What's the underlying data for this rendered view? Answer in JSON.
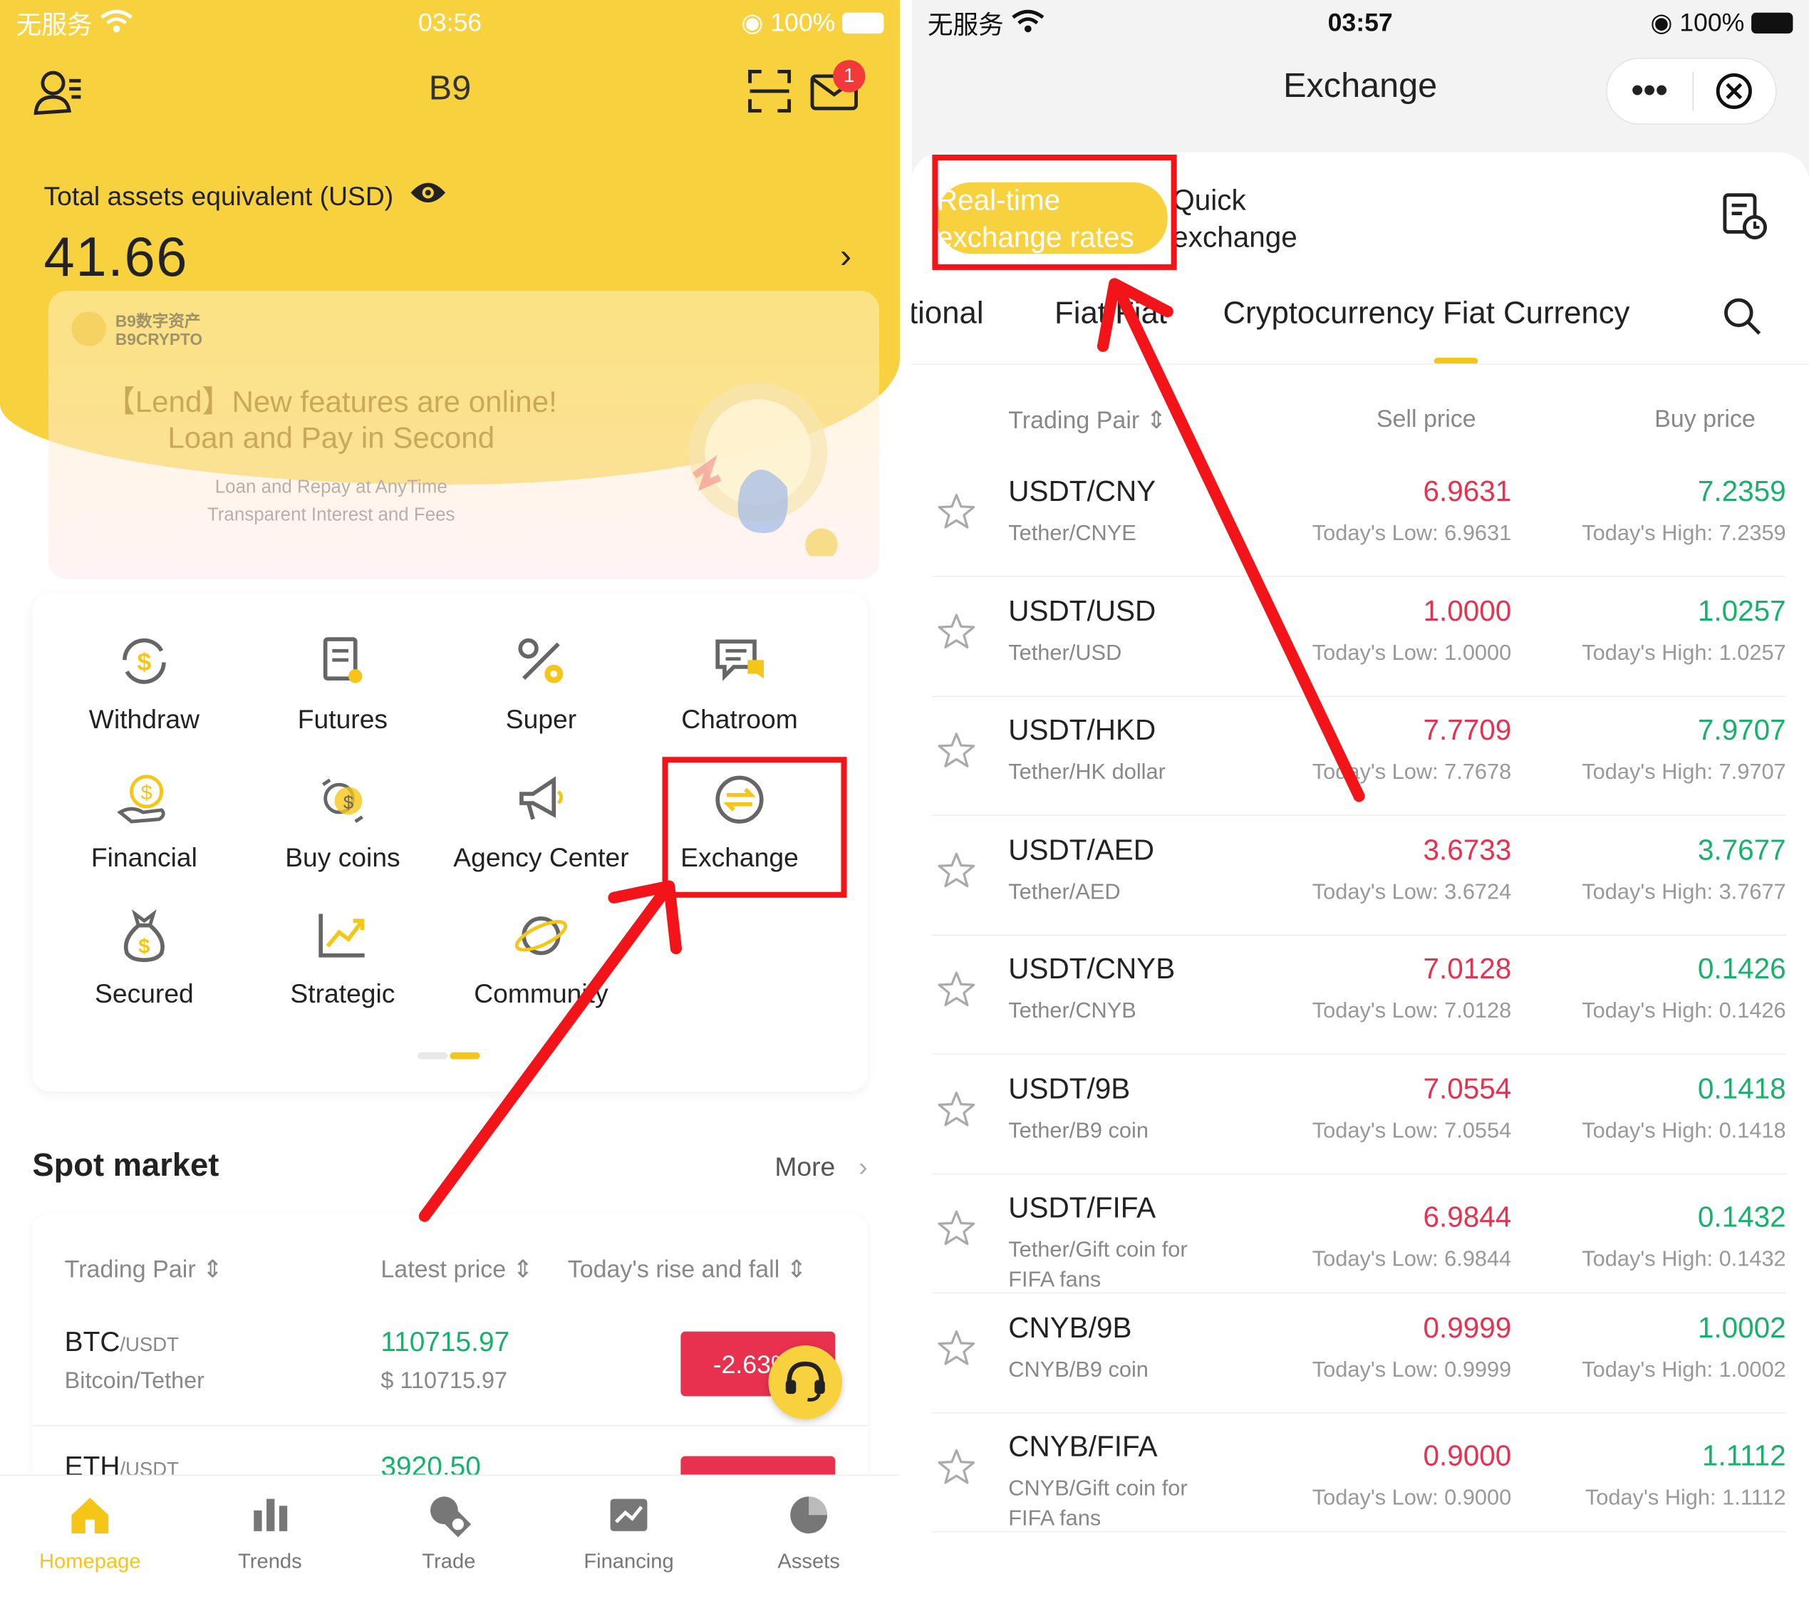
{
  "left": {
    "status": {
      "carrier": "无服务",
      "time": "03:56",
      "battery": "100%"
    },
    "header": {
      "title": "B9"
    },
    "message_badge": "1",
    "assets": {
      "label": "Total assets equivalent (USD)",
      "value": "41.66"
    },
    "banner": {
      "brand_cn": "B9数字资产",
      "brand_en": "B9CRYPTO",
      "line1": "【Lend】New features are online!",
      "line2": "Loan and Pay in Second",
      "line3": "Loan and Repay at AnyTime",
      "line4": "Transparent Interest and Fees"
    },
    "grid": [
      {
        "label": "Withdraw",
        "icon": "withdraw-icon"
      },
      {
        "label": "Futures",
        "icon": "futures-icon"
      },
      {
        "label": "Super",
        "icon": "super-icon"
      },
      {
        "label": "Chatroom",
        "icon": "chatroom-icon"
      },
      {
        "label": "Financial",
        "icon": "financial-icon"
      },
      {
        "label": "Buy coins",
        "icon": "buy-coins-icon"
      },
      {
        "label": "Agency Center",
        "icon": "megaphone-icon"
      },
      {
        "label": "Exchange",
        "icon": "exchange-icon"
      },
      {
        "label": "Secured",
        "icon": "money-bag-icon"
      },
      {
        "label": "Strategic",
        "icon": "chart-icon"
      },
      {
        "label": "Community",
        "icon": "planet-icon"
      }
    ],
    "spot": {
      "title": "Spot market",
      "more": "More",
      "col_pair": "Trading Pair",
      "col_price": "Latest price",
      "col_change": "Today's rise and fall",
      "rows": [
        {
          "base": "BTC",
          "quote": "/USDT",
          "name": "Bitcoin/Tether",
          "price": "110715.97",
          "usd": "$ 110715.97",
          "change": "-2.63"
        },
        {
          "base": "ETH",
          "quote": "/USDT",
          "name": "",
          "price": "3920.50",
          "usd": "",
          "change": ""
        }
      ]
    },
    "tabs": [
      "Homepage",
      "Trends",
      "Trade",
      "Financing",
      "Assets"
    ],
    "colors": {
      "brand": "#f7d23e",
      "active_tab": "#f5c518",
      "up": "#17b26a",
      "down": "#e8314f",
      "annotation": "#f21418"
    }
  },
  "right": {
    "status": {
      "carrier": "无服务",
      "time": "03:57",
      "battery": "100%"
    },
    "title": "Exchange",
    "modes": {
      "realtime": "Real-time exchange rates",
      "quick": "Quick exchange"
    },
    "categories": [
      "Optional",
      "Fiat Fiat",
      "Cryptocurrency Fiat Currency"
    ],
    "columns": {
      "pair": "Trading Pair",
      "sell": "Sell price",
      "buy": "Buy price"
    },
    "rows": [
      {
        "pair": "USDT/CNY",
        "name": "Tether/CNYE",
        "sell": "6.9631",
        "buy": "7.2359",
        "low": "Today's Low: 6.9631",
        "high": "Today's High: 7.2359"
      },
      {
        "pair": "USDT/USD",
        "name": "Tether/USD",
        "sell": "1.0000",
        "buy": "1.0257",
        "low": "Today's Low: 1.0000",
        "high": "Today's High: 1.0257"
      },
      {
        "pair": "USDT/HKD",
        "name": "Tether/HK dollar",
        "sell": "7.7709",
        "buy": "7.9707",
        "low": "Today's Low: 7.7678",
        "high": "Today's High: 7.9707"
      },
      {
        "pair": "USDT/AED",
        "name": "Tether/AED",
        "sell": "3.6733",
        "buy": "3.7677",
        "low": "Today's Low: 3.6724",
        "high": "Today's High: 3.7677"
      },
      {
        "pair": "USDT/CNYB",
        "name": "Tether/CNYB",
        "sell": "7.0128",
        "buy": "0.1426",
        "low": "Today's Low: 7.0128",
        "high": "Today's High: 0.1426"
      },
      {
        "pair": "USDT/9B",
        "name": "Tether/B9  coin",
        "sell": "7.0554",
        "buy": "0.1418",
        "low": "Today's Low: 7.0554",
        "high": "Today's High: 0.1418"
      },
      {
        "pair": "USDT/FIFA",
        "name": "Tether/Gift coin for FIFA fans",
        "sell": "6.9844",
        "buy": "0.1432",
        "low": "Today's Low: 6.9844",
        "high": "Today's High: 0.1432"
      },
      {
        "pair": "CNYB/9B",
        "name": "CNYB/B9  coin",
        "sell": "0.9999",
        "buy": "1.0002",
        "low": "Today's Low: 0.9999",
        "high": "Today's High: 1.0002"
      },
      {
        "pair": "CNYB/FIFA",
        "name": "CNYB/Gift coin for FIFA fans",
        "sell": "0.9000",
        "buy": "1.1112",
        "low": "Today's Low: 0.9000",
        "high": "Today's High: 1.1112"
      }
    ]
  }
}
